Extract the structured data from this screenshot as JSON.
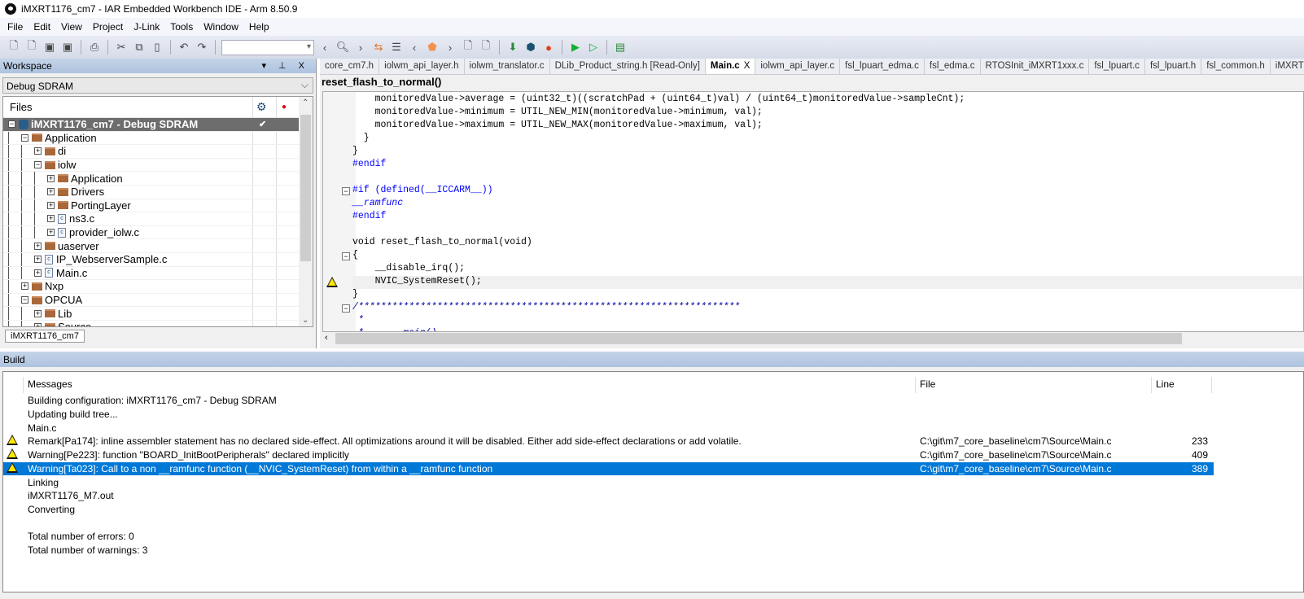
{
  "window": {
    "title": "iMXRT1176_cm7 - IAR Embedded Workbench IDE - Arm 8.50.9"
  },
  "menu": [
    "File",
    "Edit",
    "View",
    "Project",
    "J-Link",
    "Tools",
    "Window",
    "Help"
  ],
  "workspace": {
    "title": "Workspace",
    "header_icons": "▾ ⊥ X",
    "configuration": "Debug SDRAM",
    "files_header": "Files",
    "bottom_tab": "iMXRT1176_cm7",
    "tree": [
      {
        "label": "iMXRT1176_cm7 - Debug SDRAM",
        "type": "project",
        "expander": "−",
        "depth": 0,
        "selected": true,
        "check": "✔"
      },
      {
        "label": "Application",
        "type": "folder",
        "expander": "−",
        "depth": 1
      },
      {
        "label": "di",
        "type": "folder",
        "expander": "+",
        "depth": 2
      },
      {
        "label": "iolw",
        "type": "folder",
        "expander": "−",
        "depth": 2
      },
      {
        "label": "Application",
        "type": "folder",
        "expander": "+",
        "depth": 3
      },
      {
        "label": "Drivers",
        "type": "folder",
        "expander": "+",
        "depth": 3
      },
      {
        "label": "PortingLayer",
        "type": "folder",
        "expander": "+",
        "depth": 3
      },
      {
        "label": "ns3.c",
        "type": "file",
        "expander": "+",
        "depth": 3
      },
      {
        "label": "provider_iolw.c",
        "type": "file",
        "expander": "+",
        "depth": 3
      },
      {
        "label": "uaserver",
        "type": "folder",
        "expander": "+",
        "depth": 2
      },
      {
        "label": "IP_WebserverSample.c",
        "type": "file",
        "expander": "+",
        "depth": 2
      },
      {
        "label": "Main.c",
        "type": "file",
        "expander": "+",
        "depth": 2
      },
      {
        "label": "Nxp",
        "type": "folder",
        "expander": "+",
        "depth": 1
      },
      {
        "label": "OPCUA",
        "type": "folder",
        "expander": "−",
        "depth": 1
      },
      {
        "label": "Lib",
        "type": "folder",
        "expander": "+",
        "depth": 2
      },
      {
        "label": "Source",
        "type": "folder",
        "expander": "+",
        "depth": 2
      }
    ]
  },
  "editor": {
    "tabs": [
      "core_cm7.h",
      "iolwm_api_layer.h",
      "iolwm_translator.c",
      "DLib_Product_string.h [Read-Only]",
      "Main.c",
      "iolwm_api_layer.c",
      "fsl_lpuart_edma.c",
      "fsl_edma.c",
      "RTOSInit_iMXRT1xxx.c",
      "fsl_lpuart.c",
      "fsl_lpuart.h",
      "fsl_common.h",
      "iMXRT"
    ],
    "active_tab": "Main.c",
    "close_glyph": "X",
    "function": "reset_flash_to_normal()",
    "code": [
      "    monitoredValue->average = (uint32_t)((scratchPad + (uint64_t)val) / (uint64_t)monitoredValue->sampleCnt);",
      "    monitoredValue->minimum = UTIL_NEW_MIN(monitoredValue->minimum, val);",
      "    monitoredValue->maximum = UTIL_NEW_MAX(monitoredValue->maximum, val);",
      "  }",
      "}",
      "#endif",
      "",
      "#if (defined(__ICCARM__))",
      "__ramfunc",
      "#endif",
      "",
      "void reset_flash_to_normal(void)",
      "{",
      "    __disable_irq();",
      "    NVIC_SystemReset();",
      "}",
      "/********************************************************************",
      " *",
      " *       main()"
    ]
  },
  "build": {
    "title": "Build",
    "columns": {
      "messages": "Messages",
      "file": "File",
      "line": "Line"
    },
    "rows": [
      {
        "msg": "Building configuration: iMXRT1176_cm7 - Debug SDRAM",
        "file": "",
        "line": "",
        "warn": false
      },
      {
        "msg": "Updating build tree...",
        "file": "",
        "line": "",
        "warn": false
      },
      {
        "msg": "Main.c",
        "file": "",
        "line": "",
        "warn": false
      },
      {
        "msg": "Remark[Pa174]: inline assembler statement has no declared side-effect. All optimizations around it will be disabled. Either add side-effect declarations or add volatile.",
        "file": "C:\\git\\m7_core_baseline\\cm7\\Source\\Main.c",
        "line": "233",
        "warn": true
      },
      {
        "msg": "Warning[Pe223]: function \"BOARD_InitBootPeripherals\" declared implicitly",
        "file": "C:\\git\\m7_core_baseline\\cm7\\Source\\Main.c",
        "line": "409",
        "warn": true
      },
      {
        "msg": "Warning[Ta023]: Call to a non __ramfunc function (__NVIC_SystemReset) from within a __ramfunc function",
        "file": "C:\\git\\m7_core_baseline\\cm7\\Source\\Main.c",
        "line": "389",
        "warn": true,
        "selected": true
      },
      {
        "msg": "Linking",
        "file": "",
        "line": "",
        "warn": false
      },
      {
        "msg": "iMXRT1176_M7.out",
        "file": "",
        "line": "",
        "warn": false
      },
      {
        "msg": "Converting",
        "file": "",
        "line": "",
        "warn": false
      },
      {
        "msg": "",
        "file": "",
        "line": "",
        "warn": false
      },
      {
        "msg": "Total number of errors: 0",
        "file": "",
        "line": "",
        "warn": false
      },
      {
        "msg": "Total number of warnings: 3",
        "file": "",
        "line": "",
        "warn": false
      }
    ]
  },
  "colors": {
    "selection": "#0078d7",
    "keyword": "#0000ff",
    "folder": "#a8683a"
  }
}
